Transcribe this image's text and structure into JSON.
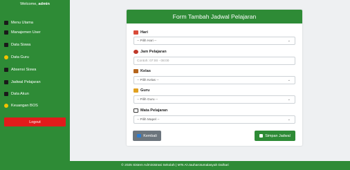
{
  "sidebar": {
    "welcome_prefix": "Welcome, ",
    "welcome_user": "admin",
    "items": [
      {
        "label": "Menu Utama",
        "icon": "home-icon",
        "color": "#1a1a1a"
      },
      {
        "label": "Manajemen User",
        "icon": "users-icon",
        "color": "#1a1a1a"
      },
      {
        "label": "Data Siswa",
        "icon": "student-icon",
        "color": "#1a1a1a"
      },
      {
        "label": "Data Guru",
        "icon": "teacher-icon",
        "color": "#f2c200"
      },
      {
        "label": "Absensi Siswa",
        "icon": "clipboard-icon",
        "color": "#1a1a1a"
      },
      {
        "label": "Jadwal Pelajaran",
        "icon": "calendar-icon",
        "color": "#1a1a1a"
      },
      {
        "label": "Data Akun",
        "icon": "account-icon",
        "color": "#1a1a1a"
      },
      {
        "label": "Keuangan BOS",
        "icon": "coin-icon",
        "color": "#f2c200"
      }
    ],
    "logout_label": "Logout"
  },
  "form": {
    "title": "Form Tambah Jadwal Pelajaran",
    "fields": [
      {
        "label": "Hari",
        "value": "-- Pilih Hari --",
        "type": "select",
        "icon": "calendar-icon",
        "icon_color": "#d94b3a"
      },
      {
        "label": "Jam Pelajaran",
        "value": "Contoh: 07:00 - 08:00",
        "type": "input",
        "icon": "clock-icon",
        "icon_color": "#c0392b"
      },
      {
        "label": "Kelas",
        "value": "-- Pilih Kelas --",
        "type": "select",
        "icon": "school-icon",
        "icon_color": "#b5651d"
      },
      {
        "label": "Guru",
        "value": "-- Pilih Guru --",
        "type": "select",
        "icon": "teacher-icon",
        "icon_color": "#e0a020"
      },
      {
        "label": "Mata Pelajaran",
        "value": "-- Pilih Mapel --",
        "type": "select",
        "icon": "book-icon",
        "icon_color": "#333333"
      }
    ],
    "back_label": "Kembali",
    "save_label": "Simpan Jadwal"
  },
  "footer": {
    "text": "© 2025 Sistem Administrasi Sekolah | MTs Al-Jauharotumalasyah Dalhari"
  },
  "colors": {
    "primary": "#2e8b36",
    "danger": "#e11b1b",
    "secondary": "#6c757d"
  }
}
